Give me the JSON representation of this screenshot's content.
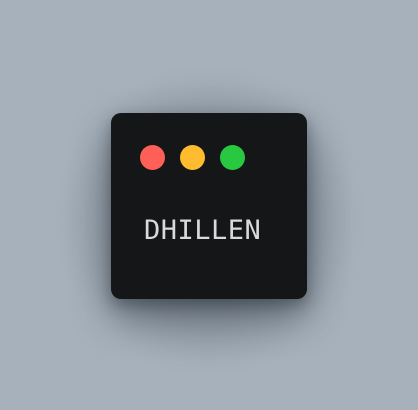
{
  "window": {
    "label": "DHILLEN",
    "controls": [
      {
        "name": "close",
        "color": "#fe5f57"
      },
      {
        "name": "minimize",
        "color": "#febc2e"
      },
      {
        "name": "maximize",
        "color": "#28c840"
      }
    ]
  },
  "colors": {
    "background": "#a6b1bb",
    "window": "#151618",
    "text": "#d9dadc"
  }
}
